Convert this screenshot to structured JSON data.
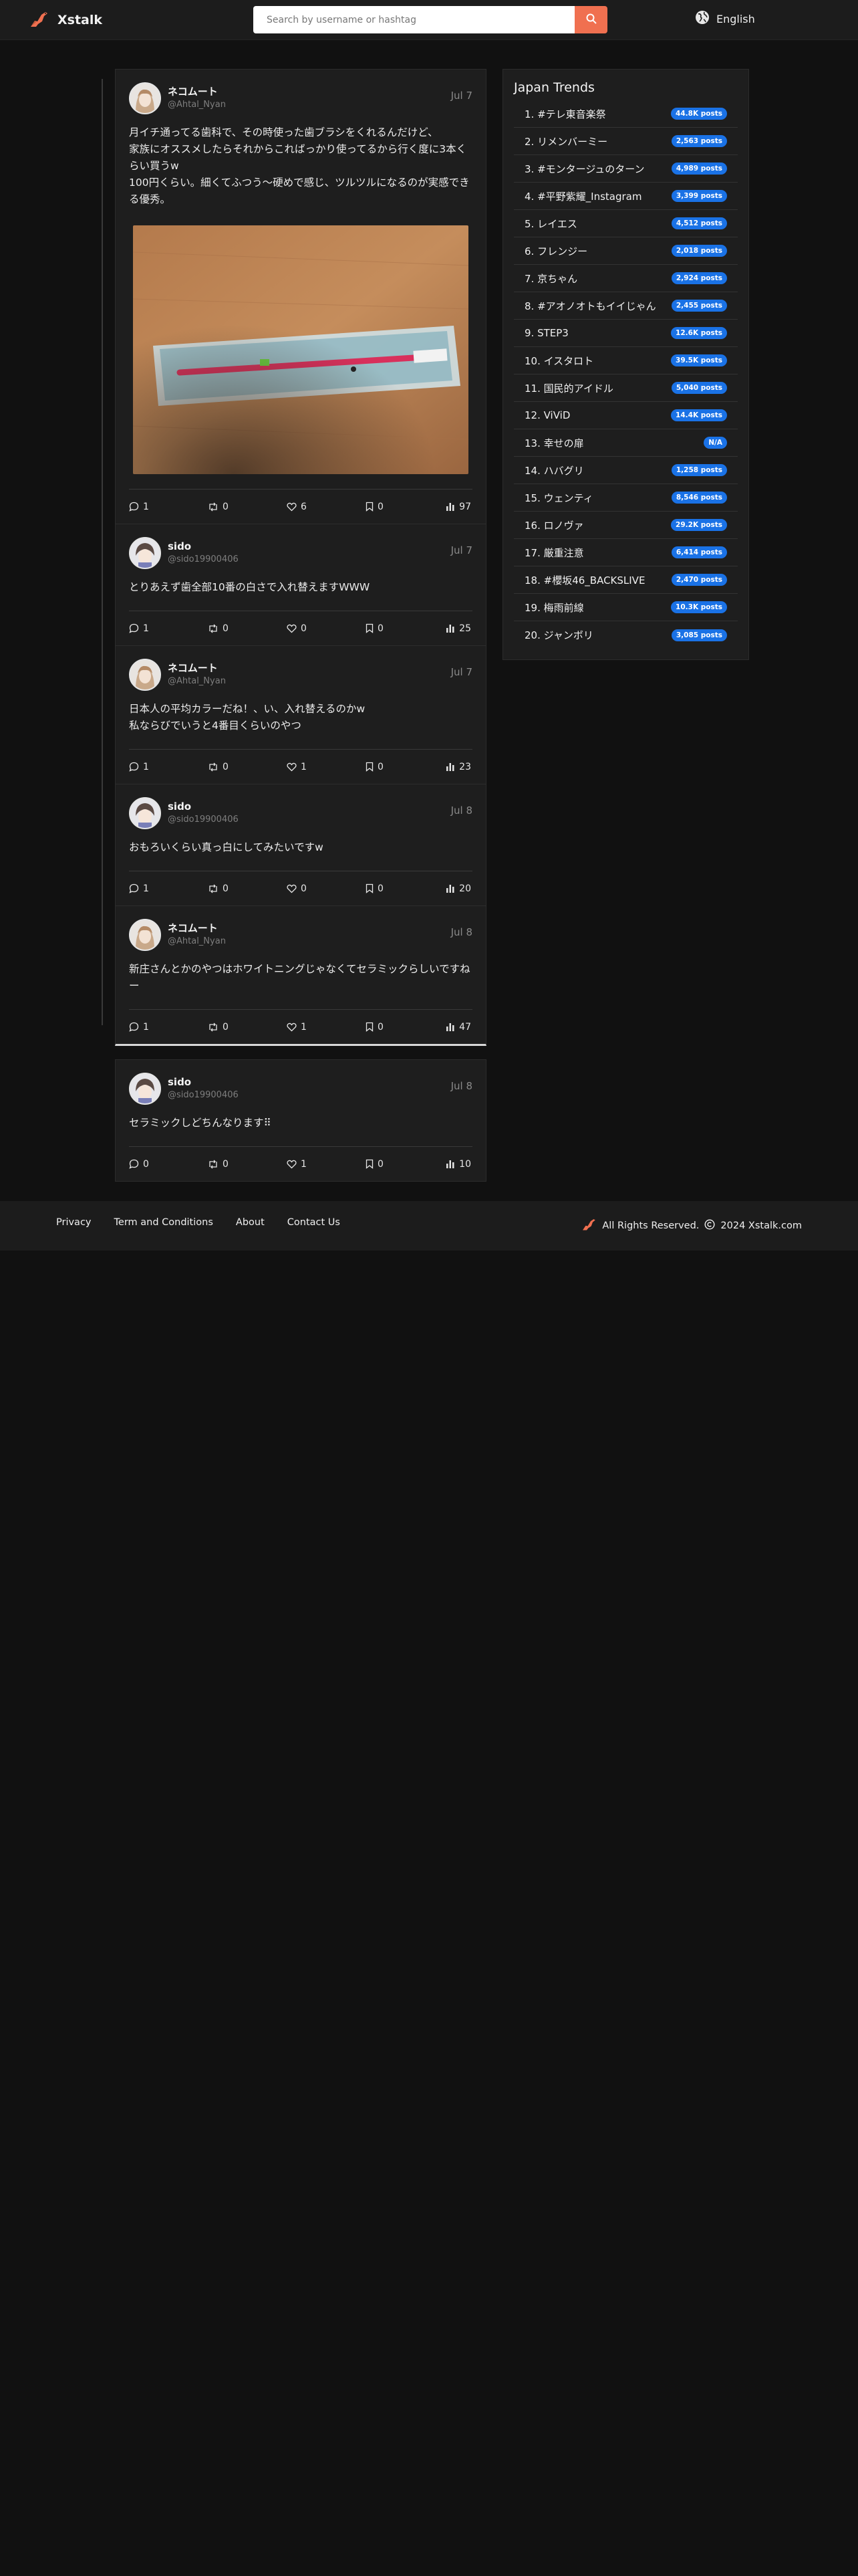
{
  "header": {
    "brand": "Xstalk",
    "search_placeholder": "Search by username or hashtag",
    "language": "English"
  },
  "thread": [
    {
      "name": "ネコムート",
      "handle": "@Ahtal_Nyan",
      "date": "Jul 7",
      "text": "月イチ通ってる歯科で、その時使った歯ブラシをくれるんだけど、\n家族にオススメしたらそれからこればっかり使ってるから行く度に3本くらい買うw\n100円くらい。細くてふつう〜硬めで感じ、ツルツルになるのが実感できる優秀。",
      "has_image": true,
      "replies": "1",
      "reposts": "0",
      "likes": "6",
      "bookmarks": "0",
      "views": "97"
    },
    {
      "name": "sido",
      "handle": "@sido19900406",
      "date": "Jul 7",
      "text": "とりあえず歯全部10番の白さで入れ替えますWWW",
      "replies": "1",
      "reposts": "0",
      "likes": "0",
      "bookmarks": "0",
      "views": "25"
    },
    {
      "name": "ネコムート",
      "handle": "@Ahtal_Nyan",
      "date": "Jul 7",
      "text": "日本人の平均カラーだね！、い、入れ替えるのかw\n私ならびでいうと4番目くらいのやつ",
      "replies": "1",
      "reposts": "0",
      "likes": "1",
      "bookmarks": "0",
      "views": "23"
    },
    {
      "name": "sido",
      "handle": "@sido19900406",
      "date": "Jul 8",
      "text": "おもろいくらい真っ白にしてみたいですw",
      "replies": "1",
      "reposts": "0",
      "likes": "0",
      "bookmarks": "0",
      "views": "20"
    },
    {
      "name": "ネコムート",
      "handle": "@Ahtal_Nyan",
      "date": "Jul 8",
      "text": "新庄さんとかのやつはホワイトニングじゃなくてセラミックらしいですねー",
      "replies": "1",
      "reposts": "0",
      "likes": "1",
      "bookmarks": "0",
      "views": "47"
    }
  ],
  "reply": {
    "name": "sido",
    "handle": "@sido19900406",
    "date": "Jul 8",
    "text": "セラミックしどちんなります⠿",
    "replies": "0",
    "reposts": "0",
    "likes": "1",
    "bookmarks": "0",
    "views": "10"
  },
  "trends": {
    "title": "Japan Trends",
    "items": [
      {
        "label": "1. #テレ東音楽祭",
        "count": "44.8K posts"
      },
      {
        "label": "2. リメンバーミー",
        "count": "2,563 posts"
      },
      {
        "label": "3. #モンタージュのターン",
        "count": "4,989 posts"
      },
      {
        "label": "4. #平野紫耀_Instagram",
        "count": "3,399 posts"
      },
      {
        "label": "5. レイエス",
        "count": "4,512 posts"
      },
      {
        "label": "6. フレンジー",
        "count": "2,018 posts"
      },
      {
        "label": "7. 京ちゃん",
        "count": "2,924 posts"
      },
      {
        "label": "8. #アオノオトもイイじゃん",
        "count": "2,455 posts"
      },
      {
        "label": "9. STEP3",
        "count": "12.6K posts"
      },
      {
        "label": "10. イスタロト",
        "count": "39.5K posts"
      },
      {
        "label": "11. 国民的アイドル",
        "count": "5,040 posts"
      },
      {
        "label": "12. ViViD",
        "count": "14.4K posts"
      },
      {
        "label": "13. 幸せの扉",
        "count": "N/A"
      },
      {
        "label": "14. ハバグリ",
        "count": "1,258 posts"
      },
      {
        "label": "15. ウェンティ",
        "count": "8,546 posts"
      },
      {
        "label": "16. ロノヴァ",
        "count": "29.2K posts"
      },
      {
        "label": "17. 厳重注意",
        "count": "6,414 posts"
      },
      {
        "label": "18. #櫻坂46_BACKSLIVE",
        "count": "2,470 posts"
      },
      {
        "label": "19. 梅雨前線",
        "count": "10.3K posts"
      },
      {
        "label": "20. ジャンボリ",
        "count": "3,085 posts"
      }
    ]
  },
  "footer": {
    "links": [
      "Privacy",
      "Term and Conditions",
      "About",
      "Contact Us"
    ],
    "copyright": "All Rights Reserved.",
    "copyright_site": "2024 Xstalk.com"
  },
  "colors": {
    "accent": "#f07050",
    "badge": "#1a72e6",
    "background": "#111111",
    "card": "#1e1e1e"
  }
}
